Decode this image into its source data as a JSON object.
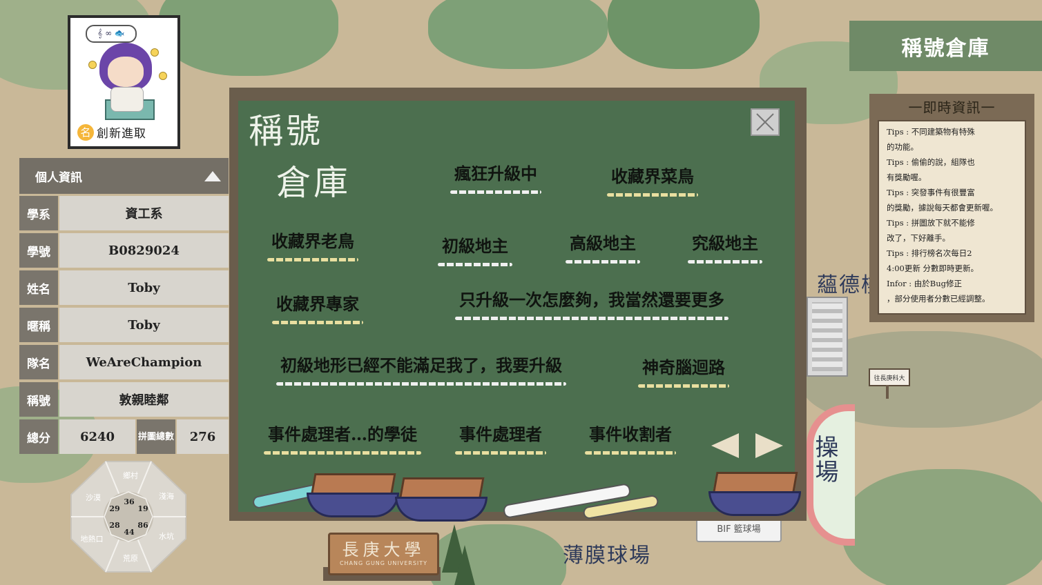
{
  "window": {
    "title": "稱號倉庫"
  },
  "avatar": {
    "bubble_text": "𝄞 ∞ 🐟",
    "badge_icon_char": "名",
    "current_title": "創新進取"
  },
  "info_panel": {
    "header": "個人資訊",
    "rows": [
      {
        "label": "學系",
        "value": "資工系"
      },
      {
        "label": "學號",
        "value": "B0829024"
      },
      {
        "label": "姓名",
        "value": "Toby"
      },
      {
        "label": "暱稱",
        "value": "Toby"
      },
      {
        "label": "隊名",
        "value": "WeAreChampion"
      },
      {
        "label": "稱號",
        "value": "敦親睦鄰"
      }
    ],
    "score": {
      "label": "總分",
      "value": "6240",
      "puzzle_label": "拼圖總數",
      "puzzle_value": "276"
    }
  },
  "terrain": {
    "segments": [
      "鄉村",
      "淺海",
      "水坑",
      "荒原",
      "地熱口",
      "沙漠"
    ],
    "values": [
      "36",
      "19",
      "86",
      "44",
      "28",
      "29"
    ]
  },
  "board": {
    "title_line1": "稱號",
    "title_line2": "倉庫",
    "titles": [
      {
        "text": "瘋狂升級中",
        "chalk": "#f0f0f0"
      },
      {
        "text": "收藏界菜鳥",
        "chalk": "#e9dfa0"
      },
      {
        "text": "收藏界老鳥",
        "chalk": "#e9dfa0"
      },
      {
        "text": "初級地主",
        "chalk": "#f0f0f0"
      },
      {
        "text": "高級地主",
        "chalk": "#f0f0f0"
      },
      {
        "text": "究級地主",
        "chalk": "#f0f0f0"
      },
      {
        "text": "收藏界專家",
        "chalk": "#e9dfa0"
      },
      {
        "text": "只升級一次怎麼夠，我當然還要更多",
        "chalk": "#f0f0f0"
      },
      {
        "text": "初級地形已經不能滿足我了，我要升級",
        "chalk": "#f0f0f0"
      },
      {
        "text": "神奇腦迴路",
        "chalk": "#e9dfa0"
      },
      {
        "text": "事件處理者…的學徒",
        "chalk": "#e9dfa0"
      },
      {
        "text": "事件處理者",
        "chalk": "#e9dfa0"
      },
      {
        "text": "事件收割者",
        "chalk": "#e9dfa0"
      }
    ]
  },
  "news": {
    "header": "一即時資訊一",
    "lines": [
      "Tips : 不同建築物有特殊",
      "的功能。",
      "Tips : 偷偷的說，組隊也",
      "有獎勵喔。",
      "Tips : 突發事件有很豐富",
      "的獎勵，據說每天都會更新喔。",
      "Tips : 拼圖放下就不能修",
      "改了，下好離手。",
      "Tips : 排行榜名次每日2",
      "4:00更新 分數即時更新。",
      "Infor : 由於Bug修正",
      "，部分使用者分數已經調整。"
    ]
  },
  "map": {
    "labels": {
      "building": "蘊德樓",
      "field": "操場",
      "court": "薄膜球場",
      "court_sign": "BIF 籃球場",
      "sign": "往長庚科大",
      "gate_main": "長庚大學",
      "gate_sub": "CHANG GUNG UNIVERSITY"
    }
  },
  "colors": {
    "board": "#4c6f4f",
    "frame": "#6a5d4c",
    "panel_label": "#7a756c",
    "panel_value": "#d8d5ce",
    "title_tab": "#6f8a67"
  }
}
